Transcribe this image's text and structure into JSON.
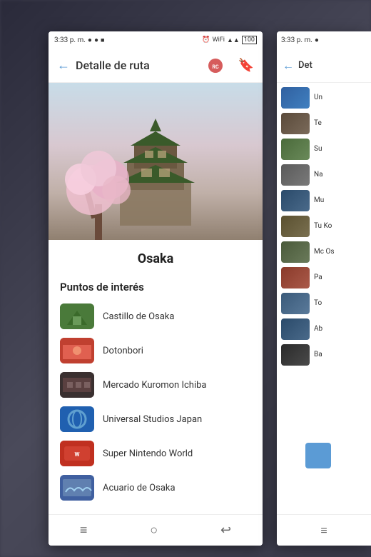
{
  "app": {
    "title": "Detalle de ruta"
  },
  "status_bar": {
    "time": "3:33 p. m.",
    "time2": "3:33 p. m."
  },
  "header": {
    "back_label": "←",
    "title": "Detalle de ruta",
    "bookmark_label": "🔖"
  },
  "hero": {
    "alt": "Osaka Castle with cherry blossoms"
  },
  "city": {
    "name": "Osaka"
  },
  "section": {
    "poi_title": "Puntos de interés"
  },
  "poi_items": [
    {
      "name": "Castillo de Osaka",
      "thumb_class": "thumb-castle"
    },
    {
      "name": "Dotonbori",
      "thumb_class": "thumb-dotonbori"
    },
    {
      "name": "Mercado Kuromon Ichiba",
      "thumb_class": "thumb-mercado"
    },
    {
      "name": "Universal Studios Japan",
      "thumb_class": "thumb-universal"
    },
    {
      "name": "Super Nintendo World",
      "thumb_class": "thumb-nintendo"
    },
    {
      "name": "Acuario de Osaka",
      "thumb_class": "thumb-acuario"
    }
  ],
  "bottom_nav": {
    "menu_icon": "≡",
    "home_icon": "○",
    "back_icon": "↩"
  },
  "side_panel": {
    "title": "Det",
    "items": [
      {
        "label": "Un",
        "class": "s1"
      },
      {
        "label": "Te",
        "class": "s2"
      },
      {
        "label": "Su",
        "class": "s3"
      },
      {
        "label": "Na",
        "class": "s4"
      },
      {
        "label": "Mu",
        "class": "s5"
      },
      {
        "label": "Tu Ko",
        "class": "s6"
      },
      {
        "label": "Mc Os",
        "class": "s7"
      },
      {
        "label": "Pa",
        "class": "s8"
      },
      {
        "label": "To",
        "class": "s9"
      },
      {
        "label": "Ab",
        "class": "s5"
      },
      {
        "label": "Ba",
        "class": "s10"
      }
    ]
  }
}
